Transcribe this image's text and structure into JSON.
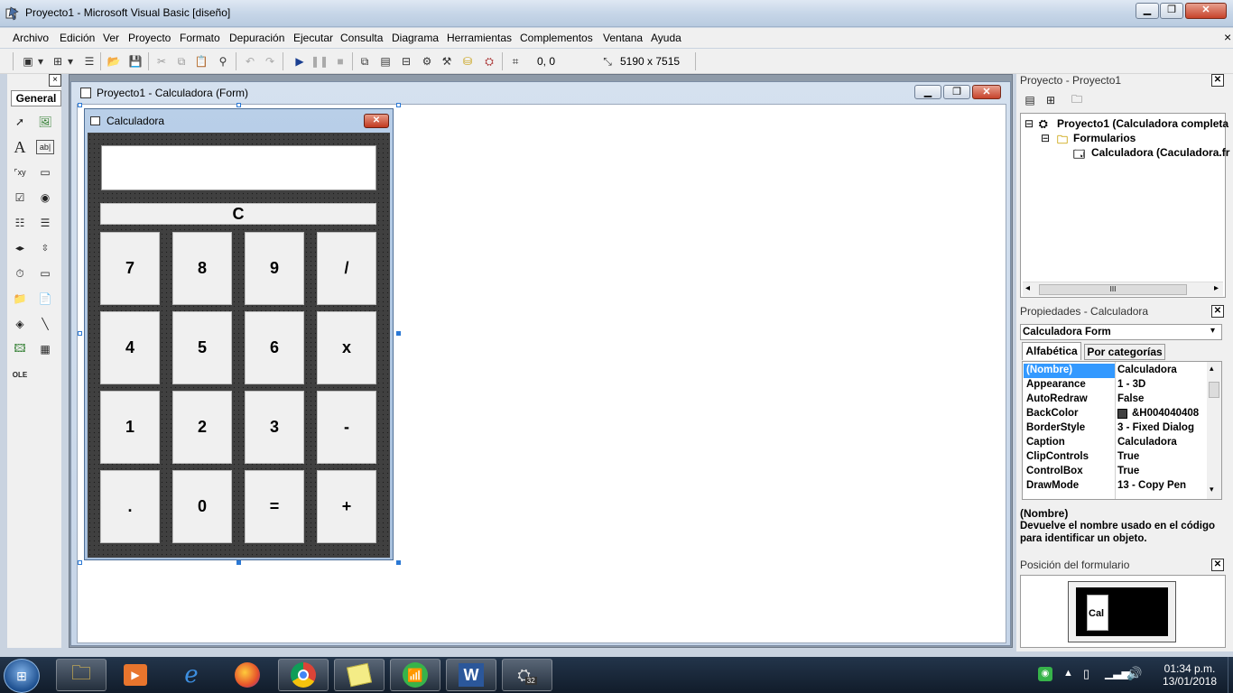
{
  "window": {
    "title": "Proyecto1 - Microsoft Visual Basic [diseño]"
  },
  "menu": [
    "Archivo",
    "Edición",
    "Ver",
    "Proyecto",
    "Formato",
    "Depuración",
    "Ejecutar",
    "Consulta",
    "Diagrama",
    "Herramientas",
    "Complementos",
    "Ventana",
    "Ayuda"
  ],
  "toolbar": {
    "position": "0, 0",
    "size": "5190 x 7515"
  },
  "toolbox": {
    "tab_label": "General",
    "close": "×"
  },
  "form_window": {
    "title": "Proyecto1 - Calculadora (Form)"
  },
  "calculator": {
    "title": "Calculadora",
    "clear_label": "C",
    "keys": [
      [
        "7",
        "8",
        "9",
        "/"
      ],
      [
        "4",
        "5",
        "6",
        "x"
      ],
      [
        "1",
        "2",
        "3",
        "-"
      ],
      [
        ".",
        "0",
        "=",
        "+"
      ]
    ]
  },
  "project_explorer": {
    "title": "Proyecto - Proyecto1",
    "tree": {
      "project": "Proyecto1 (Calculadora completa",
      "folder": "Formularios",
      "form": "Calculadora (Caculadora.fr"
    },
    "hscroll_grip": "III"
  },
  "properties": {
    "title": "Propiedades - Calculadora",
    "object_selector": "Calculadora  Form",
    "tabs": [
      "Alfabética",
      "Por categorías"
    ],
    "rows": [
      {
        "name": "(Nombre)",
        "value": "Calculadora"
      },
      {
        "name": "Appearance",
        "value": "1 - 3D"
      },
      {
        "name": "AutoRedraw",
        "value": "False"
      },
      {
        "name": "BackColor",
        "value": "&H004040408"
      },
      {
        "name": "BorderStyle",
        "value": "3 - Fixed Dialog"
      },
      {
        "name": "Caption",
        "value": "Calculadora"
      },
      {
        "name": "ClipControls",
        "value": "True"
      },
      {
        "name": "ControlBox",
        "value": "True"
      },
      {
        "name": "DrawMode",
        "value": "13 - Copy Pen"
      }
    ],
    "backcolor_swatch": "#404040",
    "description_title": "(Nombre)",
    "description_text": "Devuelve el nombre usado en el código para identificar un objeto."
  },
  "form_layout": {
    "title": "Posición del formulario",
    "preview_label": "Cal"
  },
  "taskbar": {
    "time": "01:34 p.m.",
    "date": "13/01/2018",
    "word_label": "W",
    "badge": "32"
  },
  "colors": {
    "form_back": "#404040",
    "selection": "#3399ff"
  }
}
